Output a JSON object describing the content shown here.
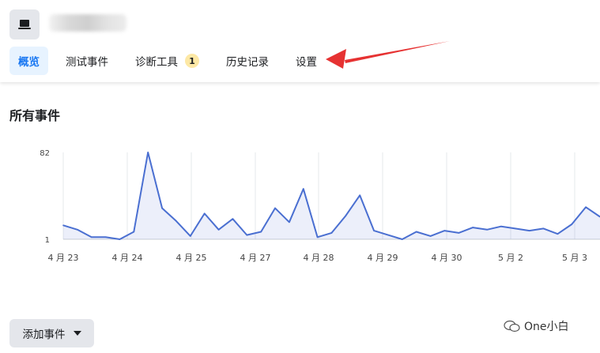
{
  "header": {
    "tabs": [
      {
        "label": "概览"
      },
      {
        "label": "测试事件"
      },
      {
        "label": "诊断工具",
        "badge": "1"
      },
      {
        "label": "历史记录"
      },
      {
        "label": "设置"
      }
    ],
    "active_tab": "概览",
    "accent_color": "#1877f2"
  },
  "main": {
    "section_title": "所有事件",
    "add_event_label": "添加事件"
  },
  "chart_data": {
    "type": "area",
    "y_ticks": [
      "82",
      "1"
    ],
    "ylim": [
      1,
      82
    ],
    "x_ticks": [
      "4 月 23",
      "4 月 24",
      "4 月 25",
      "4 月 27",
      "4 月 28",
      "4 月 29",
      "4 月 30",
      "5 月 2",
      "5 月 3"
    ],
    "series": [
      {
        "color": "#4a6fd1",
        "values": [
          14,
          10,
          3,
          3,
          1,
          8,
          82,
          30,
          18,
          4,
          25,
          10,
          20,
          5,
          8,
          30,
          17,
          48,
          3,
          7,
          23,
          42,
          9,
          5,
          1,
          8,
          4,
          9,
          7,
          12,
          10,
          13,
          11,
          9,
          11,
          6,
          15,
          31,
          22
        ]
      }
    ]
  },
  "watermark": {
    "text": "One小白"
  }
}
